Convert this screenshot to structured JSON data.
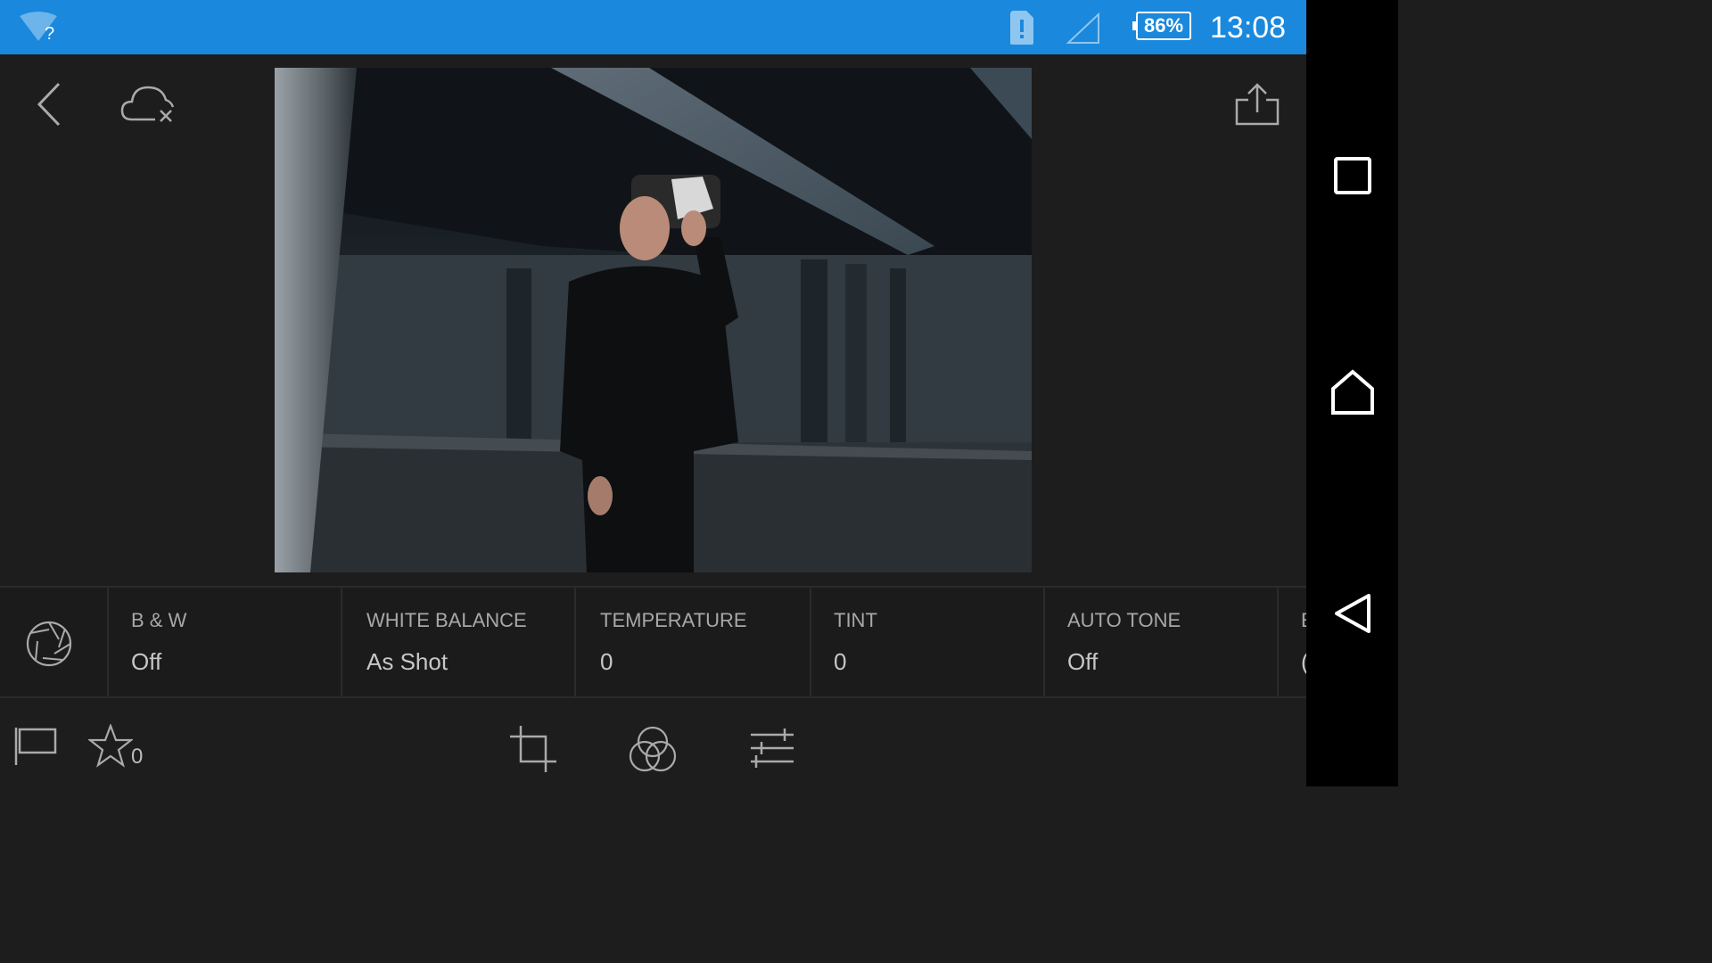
{
  "status_bar": {
    "battery": "86%",
    "time": "13:08",
    "wifi_badge": "?",
    "background": "#1a88dc"
  },
  "params": [
    {
      "label": "B & W",
      "value": "Off"
    },
    {
      "label": "WHITE BALANCE",
      "value": "As Shot"
    },
    {
      "label": "TEMPERATURE",
      "value": "0"
    },
    {
      "label": "TINT",
      "value": "0"
    },
    {
      "label": "AUTO TONE",
      "value": "Off"
    },
    {
      "label": "E",
      "value": "("
    }
  ],
  "rating": {
    "stars": "0"
  },
  "icons": {
    "back": "back-arrow-icon",
    "cloud": "cloud-offline-icon",
    "share": "share-icon",
    "preset": "aperture-icon",
    "flag": "flag-icon",
    "star": "star-icon",
    "crop": "crop-icon",
    "presets": "circles-icon",
    "adjust": "sliders-icon"
  }
}
